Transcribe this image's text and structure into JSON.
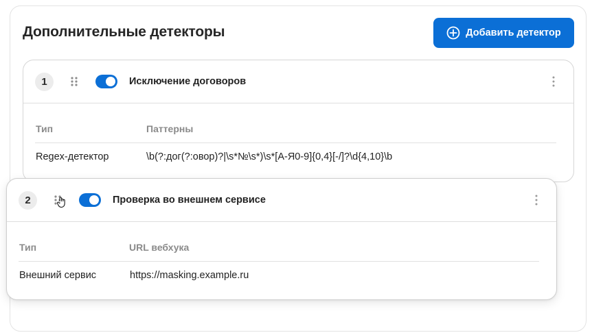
{
  "panel": {
    "title": "Дополнительные детекторы",
    "add_button_label": "Добавить детектор"
  },
  "detectors": [
    {
      "number": "1",
      "title": "Исключение договоров",
      "enabled": true,
      "col_type_header": "Тип",
      "col_value_header": "Паттерны",
      "type_value": "Regex-детектор",
      "value": "\\b(?:дог(?:овор)?|\\s*№\\s*)\\s*[А-Я0-9]{0,4}[-/]?\\d{4,10}\\b"
    },
    {
      "number": "2",
      "title": "Проверка во внешнем сервисе",
      "enabled": true,
      "col_type_header": "Тип",
      "col_value_header": "URL вебхука",
      "type_value": "Внешний сервис",
      "value": "https://masking.example.ru"
    }
  ],
  "colors": {
    "accent": "#0b6fd6",
    "muted_header": "#8a8a8a"
  },
  "icons": {
    "add": "plus-circle-icon",
    "drag": "drag-handle-icon",
    "menu": "kebab-menu-icon",
    "cursor": "grab-cursor-icon"
  }
}
